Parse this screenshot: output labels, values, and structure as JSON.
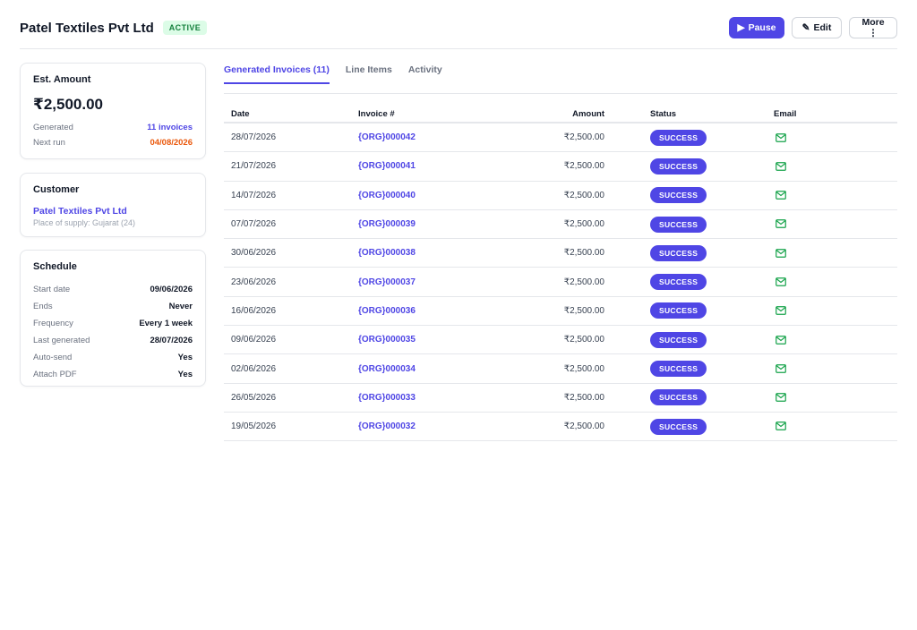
{
  "header": {
    "title": "Patel Textiles Pvt Ltd",
    "status_badge": "ACTIVE",
    "pause_label": "Pause",
    "edit_label": "Edit",
    "more_label": "More ⋮"
  },
  "summary": {
    "title": "Est. Amount",
    "amount": "₹2,500.00",
    "generated_label": "Generated",
    "generated_value": "11 invoices",
    "next_run_label": "Next run",
    "next_run_value": "04/08/2026"
  },
  "customer": {
    "title": "Customer",
    "name": "Patel Textiles Pvt Ltd",
    "place_of_supply": "Place of supply: Gujarat (24)"
  },
  "schedule": {
    "title": "Schedule",
    "items": [
      {
        "label": "Start date",
        "value": "09/06/2026"
      },
      {
        "label": "Ends",
        "value": "Never"
      },
      {
        "label": "Frequency",
        "value": "Every 1 week"
      },
      {
        "label": "Last generated",
        "value": "28/07/2026"
      },
      {
        "label": "Auto-send",
        "value": "Yes"
      },
      {
        "label": "Attach PDF",
        "value": "Yes"
      }
    ]
  },
  "tabs": [
    {
      "label": "Generated Invoices (11)"
    },
    {
      "label": "Line Items"
    },
    {
      "label": "Activity"
    }
  ],
  "table": {
    "headers": {
      "date": "Date",
      "invoice": "Invoice #",
      "amount": "Amount",
      "status": "Status",
      "email": "Email"
    },
    "rows": [
      {
        "date": "28/07/2026",
        "invoice": "{ORG}000042",
        "amount": "₹2,500.00",
        "status": "SUCCESS"
      },
      {
        "date": "21/07/2026",
        "invoice": "{ORG}000041",
        "amount": "₹2,500.00",
        "status": "SUCCESS"
      },
      {
        "date": "14/07/2026",
        "invoice": "{ORG}000040",
        "amount": "₹2,500.00",
        "status": "SUCCESS"
      },
      {
        "date": "07/07/2026",
        "invoice": "{ORG}000039",
        "amount": "₹2,500.00",
        "status": "SUCCESS"
      },
      {
        "date": "30/06/2026",
        "invoice": "{ORG}000038",
        "amount": "₹2,500.00",
        "status": "SUCCESS"
      },
      {
        "date": "23/06/2026",
        "invoice": "{ORG}000037",
        "amount": "₹2,500.00",
        "status": "SUCCESS"
      },
      {
        "date": "16/06/2026",
        "invoice": "{ORG}000036",
        "amount": "₹2,500.00",
        "status": "SUCCESS"
      },
      {
        "date": "09/06/2026",
        "invoice": "{ORG}000035",
        "amount": "₹2,500.00",
        "status": "SUCCESS"
      },
      {
        "date": "02/06/2026",
        "invoice": "{ORG}000034",
        "amount": "₹2,500.00",
        "status": "SUCCESS"
      },
      {
        "date": "26/05/2026",
        "invoice": "{ORG}000033",
        "amount": "₹2,500.00",
        "status": "SUCCESS"
      },
      {
        "date": "19/05/2026",
        "invoice": "{ORG}000032",
        "amount": "₹2,500.00",
        "status": "SUCCESS"
      }
    ]
  },
  "colors": {
    "accent": "#4f46e5",
    "success_bg": "#dcfce7",
    "success_text": "#15803d",
    "email_icon": "#16a34a",
    "next_run": "#ea580c"
  },
  "icons": {
    "pause": "play-icon",
    "edit": "pencil-icon",
    "email": "mail-icon"
  }
}
